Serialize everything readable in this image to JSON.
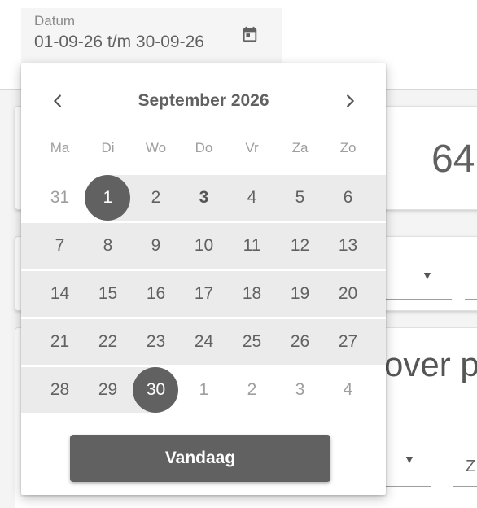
{
  "date_field": {
    "label": "Datum",
    "value": "01-09-26 t/m 30-09-26"
  },
  "background": {
    "number": "64",
    "heading": "over pe",
    "z_text": "Z"
  },
  "picker": {
    "month_title": "September 2026",
    "weekdays": [
      "Ma",
      "Di",
      "Wo",
      "Do",
      "Vr",
      "Za",
      "Zo"
    ],
    "weeks": [
      [
        "31",
        "1",
        "2",
        "3",
        "4",
        "5",
        "6"
      ],
      [
        "7",
        "8",
        "9",
        "10",
        "11",
        "12",
        "13"
      ],
      [
        "14",
        "15",
        "16",
        "17",
        "18",
        "19",
        "20"
      ],
      [
        "21",
        "22",
        "23",
        "24",
        "25",
        "26",
        "27"
      ],
      [
        "28",
        "29",
        "30",
        "1",
        "2",
        "3",
        "4"
      ]
    ],
    "today_button": "Vandaag"
  },
  "colors": {
    "accent": "#616161",
    "range": "#ebebeb"
  },
  "icons": {
    "calendar": "calendar-icon",
    "prev": "chevron-left-icon",
    "next": "chevron-right-icon"
  }
}
